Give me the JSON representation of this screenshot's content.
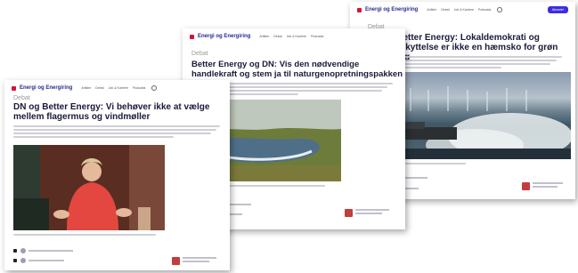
{
  "site": {
    "brand": "Energi og Energiring",
    "nav": [
      "Artikler",
      "Debat",
      "Job & Karriere",
      "Podcasts"
    ],
    "subscribe": "Abonnér"
  },
  "articles": [
    {
      "section": "Debat",
      "headline": "DN og Better Energy: Lokaldemokrati og naturbeskyttelse er ikke en hæmsko for grøn omstilling"
    },
    {
      "section": "Debat",
      "headline": "Better Energy og DN: Vis den nødvendige handlekraft og stem ja til naturgenopretningspakken"
    },
    {
      "section": "Debat",
      "headline": "DN og Better Energy: Vi behøver ikke at vælge mellem flagermus og vindmøller"
    }
  ],
  "colors": {
    "brand_red": "#d8123a",
    "brand_blue": "#2a2a8f",
    "subscribe_bg": "#3d2ee0"
  }
}
